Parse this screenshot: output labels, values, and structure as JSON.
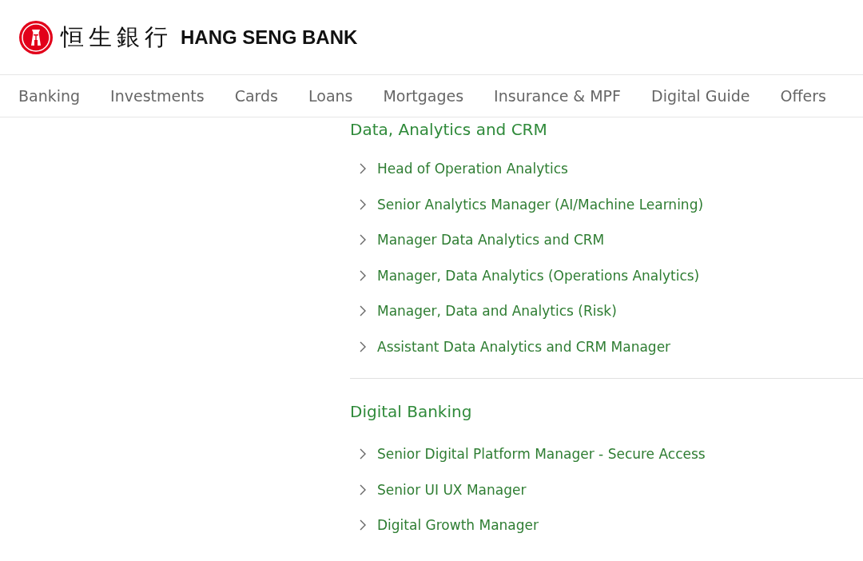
{
  "header": {
    "logo_chinese": "恒生銀行",
    "logo_english": "HANG SENG BANK"
  },
  "nav": {
    "items": [
      {
        "label": "Banking"
      },
      {
        "label": "Investments"
      },
      {
        "label": "Cards"
      },
      {
        "label": "Loans"
      },
      {
        "label": "Mortgages"
      },
      {
        "label": "Insurance & MPF"
      },
      {
        "label": "Digital Guide"
      },
      {
        "label": "Offers"
      }
    ]
  },
  "sections": [
    {
      "title": "Data, Analytics and CRM",
      "jobs": [
        "Head of Operation Analytics",
        "Senior Analytics Manager (AI/Machine Learning)",
        "Manager Data Analytics and CRM",
        "Manager, Data Analytics (Operations Analytics)",
        "Manager, Data and Analytics (Risk)",
        "Assistant Data Analytics and CRM Manager"
      ]
    },
    {
      "title": "Digital Banking",
      "jobs": [
        "Senior Digital Platform Manager - Secure Access",
        "Senior UI UX Manager",
        "Digital Growth Manager"
      ]
    }
  ]
}
